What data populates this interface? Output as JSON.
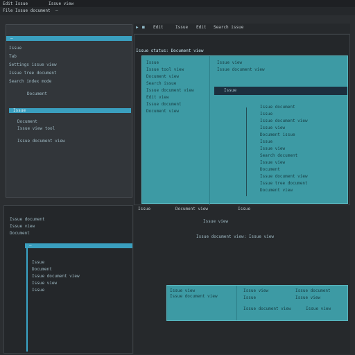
{
  "app": {
    "title": "Edit Issue",
    "title_extra": "Issue view"
  },
  "menu": {
    "left": "File Issue document",
    "right": "—"
  },
  "explorer": {
    "header": "—",
    "items": [
      "Issue",
      "Tab",
      "Settings issue view",
      "Issue tree document",
      "Search index mode",
      "Document"
    ],
    "subheader": "Issue",
    "subitems": [
      "Document",
      "Issue view tool",
      "Issue document view"
    ]
  },
  "toolbar": {
    "items": [
      "Edit",
      "Issue",
      "Edit",
      "Search issue"
    ]
  },
  "editor": {
    "status": "Issue status: Document view",
    "lines": [
      "Issue",
      "Issue tool view",
      "Document view",
      "Search issue",
      "Issue document view",
      "Edit view",
      "Issue document",
      "Document view"
    ],
    "right_header": "Issue view",
    "right_line": "Issue document view",
    "selected_label": "Issue",
    "code": [
      "Issue document",
      "Issue",
      "Issue document view",
      "Issue view",
      "Document issue",
      "Issue",
      "Issue view",
      "Search document",
      "Issue view",
      "Document",
      "Issue document view",
      "Issue tree document",
      "Document view"
    ]
  },
  "bottom_left": {
    "lines": [
      "Issue document",
      "Issue view",
      "Document"
    ],
    "header": "—",
    "tree": [
      "Issue",
      "Document",
      "Issue document view",
      "Issue view",
      "Issue"
    ]
  },
  "bottom_right": {
    "tabs": [
      "Issue",
      "Document view",
      "Issue"
    ],
    "title": "Issue view",
    "subtitle": "Issue document view: Issue view",
    "dialog": {
      "left_header": "Issue view",
      "left_line": "Issue document view",
      "right_col1": [
        "Issue view",
        "Issue",
        "Issue document view"
      ],
      "right_col2": [
        "Issue document",
        "Issue view",
        "Issue view"
      ]
    }
  }
}
